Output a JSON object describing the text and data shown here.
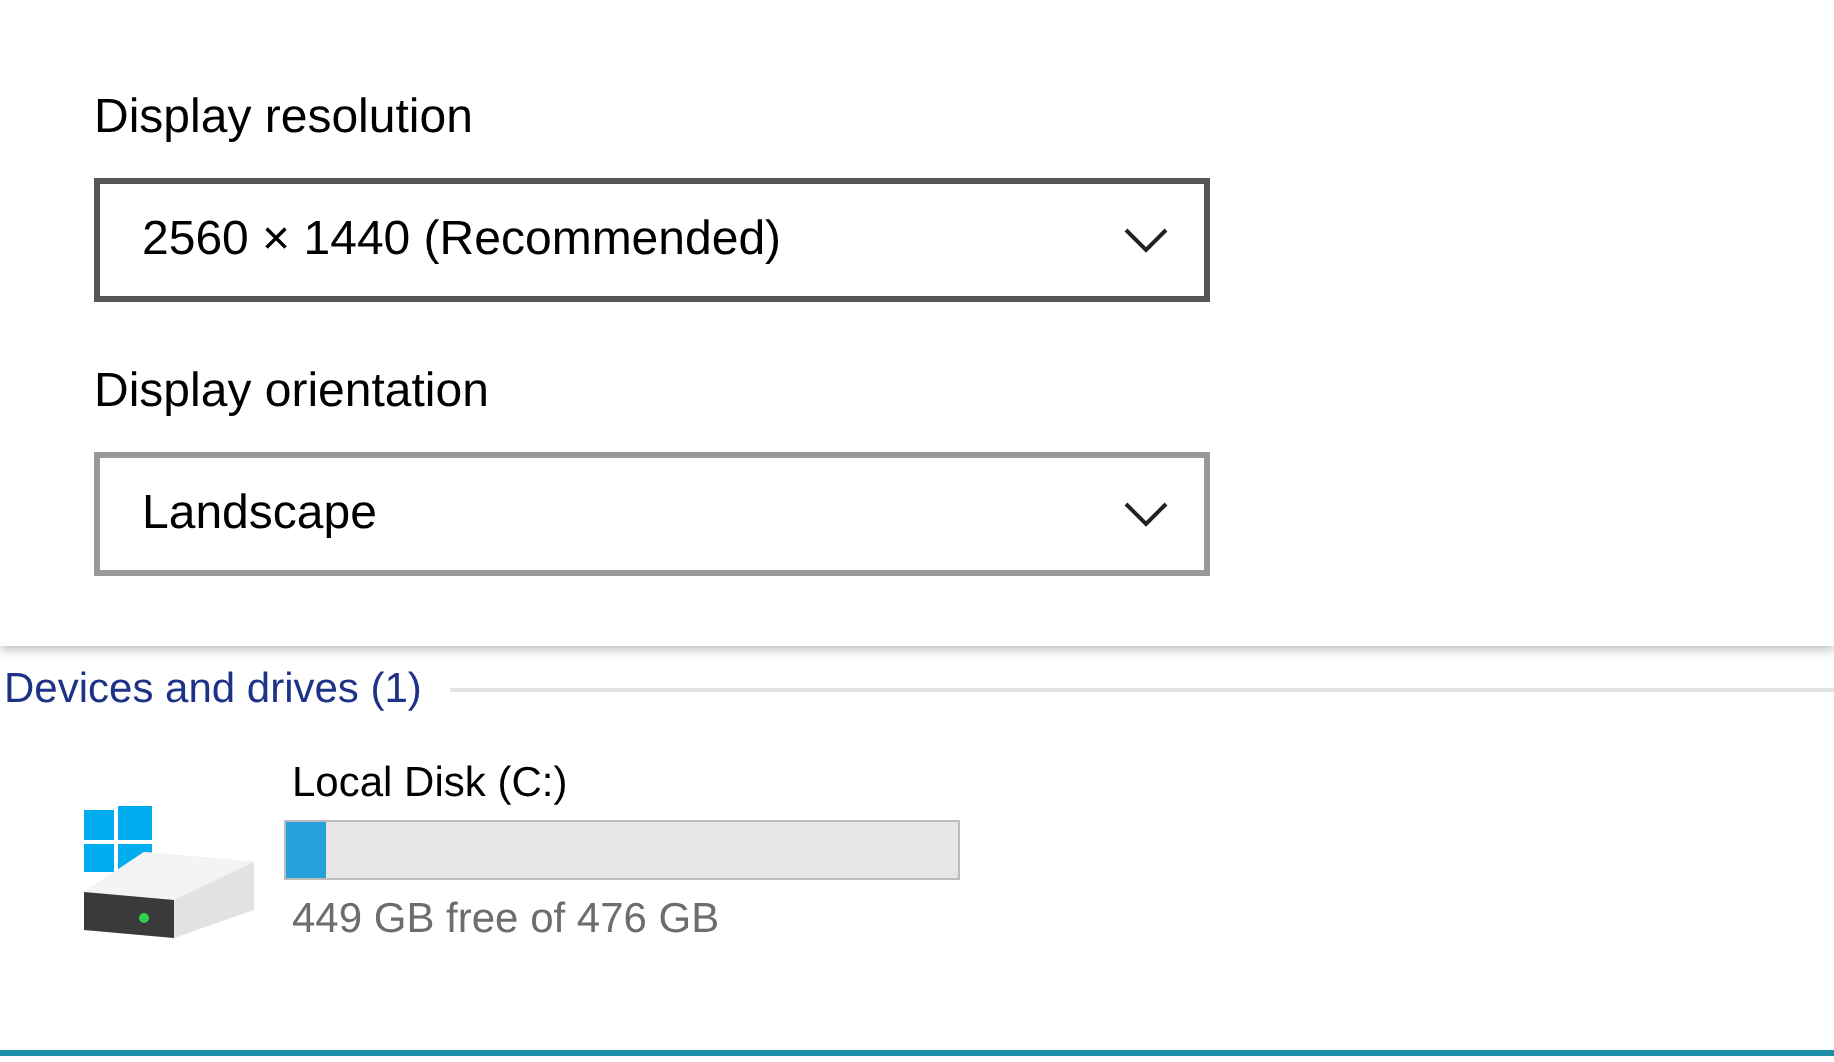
{
  "settings": {
    "fields": [
      {
        "label": "Display resolution",
        "value": "2560 × 1440 (Recommended)",
        "focused": true
      },
      {
        "label": "Display orientation",
        "value": "Landscape",
        "focused": false
      }
    ]
  },
  "explorer": {
    "group": {
      "title": "Devices and drives (1)"
    },
    "drives": [
      {
        "name": "Local Disk (C:)",
        "level": 0.06,
        "reading": "449 GB free of 476 GB"
      }
    ]
  }
}
